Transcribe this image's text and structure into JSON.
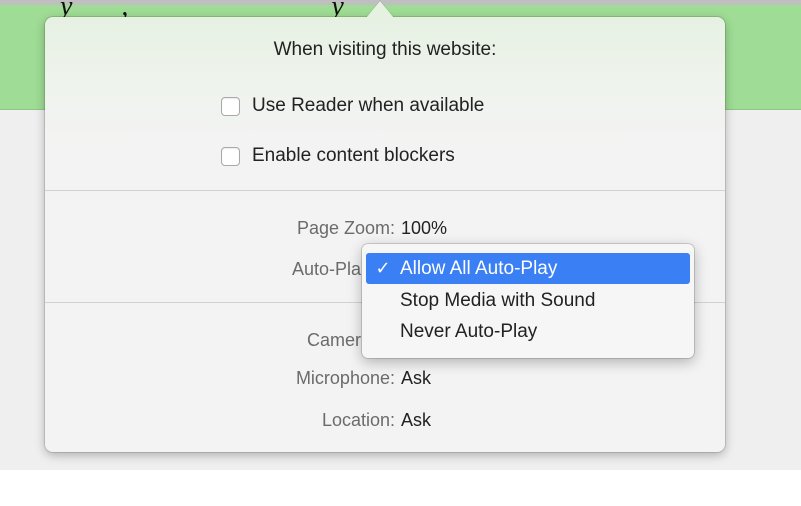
{
  "background_page": {
    "clipped_top_text": "y       ,                             y"
  },
  "popover": {
    "title": "When visiting this website:",
    "checkboxes": [
      {
        "label": "Use Reader when available",
        "checked": false
      },
      {
        "label": "Enable content blockers",
        "checked": false
      }
    ],
    "settings": [
      {
        "label": "Page Zoom:",
        "value": "100%"
      },
      {
        "label": "Auto-Pla",
        "value": ""
      },
      {
        "label": "Camer",
        "value": ""
      },
      {
        "label": "Microphone:",
        "value": "Ask"
      },
      {
        "label": "Location:",
        "value": "Ask"
      }
    ]
  },
  "autoplay_menu": {
    "items": [
      {
        "label": "Allow All Auto-Play",
        "selected": true,
        "check": "✓"
      },
      {
        "label": "Stop Media with Sound",
        "selected": false,
        "check": ""
      },
      {
        "label": "Never Auto-Play",
        "selected": false,
        "check": ""
      }
    ]
  },
  "colors": {
    "header_green": "#9fdc95",
    "selection_blue": "#3a7ff4"
  }
}
